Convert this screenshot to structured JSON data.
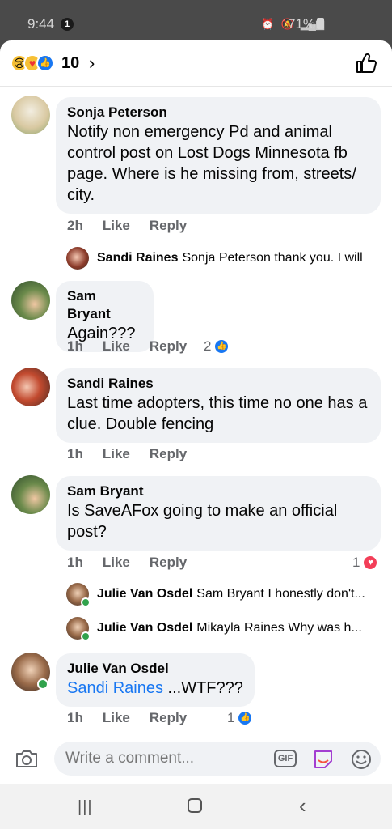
{
  "status": {
    "time": "9:44",
    "notif_count": "1",
    "battery": "71%"
  },
  "reactions": {
    "count": "10"
  },
  "comments": [
    {
      "name": "Sonja Peterson",
      "text": "Notify non emergency Pd and animal control post on Lost Dogs Minnesota fb page. Where is he missing from, streets/ city.",
      "time": "2h",
      "like": "Like",
      "reply": "Reply"
    },
    {
      "name": "Sam Bryant",
      "text": "Again???",
      "time": "1h",
      "like": "Like",
      "reply": "Reply",
      "reaction_count": "2"
    },
    {
      "name": "Sandi Raines",
      "text": "Last time adopters, this time no one has a clue. Double fencing",
      "time": "1h",
      "like": "Like",
      "reply": "Reply"
    },
    {
      "name": "Sam Bryant",
      "text": "Is SaveAFox going to make an official post?",
      "time": "1h",
      "like": "Like",
      "reply": "Reply",
      "reaction_count": "1"
    },
    {
      "name": "Julie Van Osdel",
      "mention": "Sandi Raines",
      "text": " ...WTF???",
      "time": "1h",
      "like": "Like",
      "reply": "Reply",
      "reaction_count": "1"
    }
  ],
  "replies": [
    {
      "name": "Sandi Raines",
      "text": "Sonja Peterson thank you. I will"
    },
    {
      "name": "Julie Van Osdel",
      "text": "Sam Bryant I honestly don't..."
    },
    {
      "name": "Julie Van Osdel",
      "text": "Mikayla Raines  Why was h..."
    }
  ],
  "composer": {
    "placeholder": "Write a comment...",
    "gif_label": "GIF"
  }
}
